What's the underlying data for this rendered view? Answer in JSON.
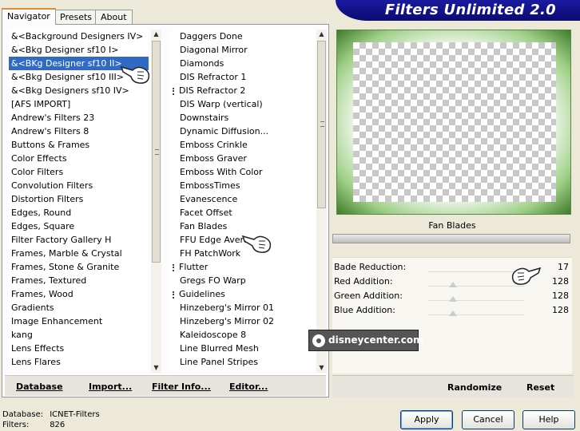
{
  "banner": {
    "title": "Filters Unlimited 2.0"
  },
  "tabs": [
    {
      "label": "Navigator",
      "active": true
    },
    {
      "label": "Presets",
      "active": false
    },
    {
      "label": "About",
      "active": false
    }
  ],
  "categories": {
    "items": [
      "&<Background Designers IV>",
      "&<Bkg Designer sf10 I>",
      "&<BKg Designer sf10 II>",
      "&<Bkg Designer sf10 III>",
      "&<Bkg Designers sf10 IV>",
      "[AFS IMPORT]",
      "Andrew's Filters 23",
      "Andrew's Filters 8",
      "Buttons & Frames",
      "Color Effects",
      "Color Filters",
      "Convolution Filters",
      "Distortion Filters",
      "Edges, Round",
      "Edges, Square",
      "Filter Factory Gallery H",
      "Frames, Marble & Crystal",
      "Frames, Stone & Granite",
      "Frames, Textured",
      "Frames, Wood",
      "Gradients",
      "Image Enhancement",
      "kang",
      "Lens Effects",
      "Lens Flares"
    ],
    "selected_index": 2
  },
  "filters": {
    "items": [
      {
        "label": "Daggers Done",
        "mark": false
      },
      {
        "label": "Diagonal Mirror",
        "mark": false
      },
      {
        "label": "Diamonds",
        "mark": false
      },
      {
        "label": "DIS Refractor 1",
        "mark": false
      },
      {
        "label": "DIS Refractor 2",
        "mark": true
      },
      {
        "label": "DIS Warp (vertical)",
        "mark": false
      },
      {
        "label": "Downstairs",
        "mark": false
      },
      {
        "label": "Dynamic Diffusion...",
        "mark": false
      },
      {
        "label": "Emboss Crinkle",
        "mark": false
      },
      {
        "label": "Emboss Graver",
        "mark": false
      },
      {
        "label": "Emboss With Color",
        "mark": false
      },
      {
        "label": "EmbossTimes",
        "mark": false
      },
      {
        "label": "Evanescence",
        "mark": false
      },
      {
        "label": "Facet Offset",
        "mark": false
      },
      {
        "label": "Fan Blades",
        "mark": false
      },
      {
        "label": "FFU Edge Avera",
        "mark": false
      },
      {
        "label": "FH PatchWork",
        "mark": false
      },
      {
        "label": "Flutter",
        "mark": true
      },
      {
        "label": "Gregs FO Warp",
        "mark": false
      },
      {
        "label": "Guidelines",
        "mark": true
      },
      {
        "label": "Hinzeberg's Mirror 01",
        "mark": false
      },
      {
        "label": "Hinzeberg's Mirror 02",
        "mark": false
      },
      {
        "label": "Kaleidoscope 8",
        "mark": false
      },
      {
        "label": "Line Blurred Mesh",
        "mark": false
      },
      {
        "label": "Line Panel Stripes",
        "mark": false
      }
    ]
  },
  "toolbar": {
    "database": "Database",
    "import": "Import...",
    "filter_info": "Filter Info...",
    "editor": "Editor..."
  },
  "preview": {
    "filter_name": "Fan Blades"
  },
  "params": [
    {
      "label": "Bade Reduction:",
      "value": "17"
    },
    {
      "label": "Red Addition:",
      "value": "128"
    },
    {
      "label": "Green Addition:",
      "value": "128"
    },
    {
      "label": "Blue Addition:",
      "value": "128"
    }
  ],
  "right_toolbar": {
    "randomize": "Randomize",
    "reset": "Reset"
  },
  "status": {
    "database_label": "Database:",
    "database_value": "ICNET-Filters",
    "filters_label": "Filters:",
    "filters_value": "826"
  },
  "buttons": {
    "apply": "Apply",
    "cancel": "Cancel",
    "help": "Help"
  },
  "watermark": "disneycenter.com"
}
